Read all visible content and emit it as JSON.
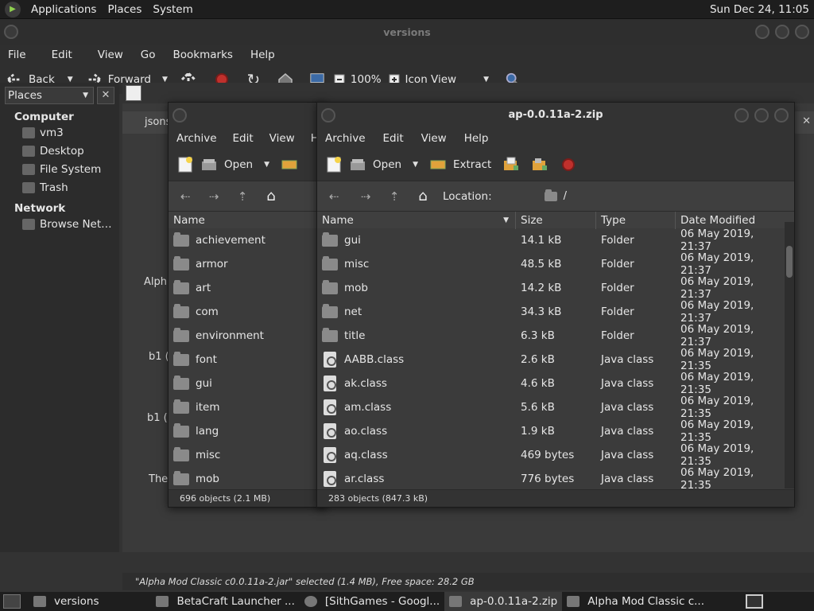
{
  "topbar": {
    "menus": [
      "Applications",
      "Places",
      "System"
    ],
    "clock": "Sun Dec 24, 11:05"
  },
  "versions_window": {
    "title": "versions",
    "menus": [
      "File",
      "Edit",
      "View",
      "Go",
      "Bookmarks",
      "Help"
    ],
    "toolbar": {
      "back": "Back",
      "forward": "Forward",
      "zoom": "100%",
      "view_mode": "Icon View"
    },
    "sidebar": {
      "combo": "Places",
      "computer_header": "Computer",
      "computer_items": [
        "vm3",
        "Desktop",
        "File System",
        "Trash"
      ],
      "network_header": "Network",
      "network_items": [
        "Browse Net…"
      ]
    },
    "tab_label": "jsons",
    "background_fragments": [
      "Alph",
      "b1 (",
      "b1 (1",
      "The"
    ],
    "status": "\"Alpha Mod Classic c0.0.11a-2.jar\" selected (1.4 MB), Free space: 28.2 GB"
  },
  "archive_left": {
    "menus": [
      "Archive",
      "Edit",
      "View",
      "Hel"
    ],
    "toolbar": {
      "open": "Open"
    },
    "column_name": "Name",
    "items": [
      "achievement",
      "armor",
      "art",
      "com",
      "environment",
      "font",
      "gui",
      "item",
      "lang",
      "misc",
      "mob"
    ],
    "status": "696 objects (2.1 MB)"
  },
  "archive_right": {
    "title": "ap-0.0.11a-2.zip",
    "menus": [
      "Archive",
      "Edit",
      "View",
      "Help"
    ],
    "toolbar": {
      "open": "Open",
      "extract": "Extract"
    },
    "location_label": "Location:",
    "location_value": "/",
    "columns": {
      "name": "Name",
      "size": "Size",
      "type": "Type",
      "date": "Date Modified"
    },
    "rows": [
      {
        "name": "gui",
        "size": "14.1 kB",
        "type": "Folder",
        "date": "06 May 2019, 21:37",
        "kind": "folder"
      },
      {
        "name": "misc",
        "size": "48.5 kB",
        "type": "Folder",
        "date": "06 May 2019, 21:37",
        "kind": "folder"
      },
      {
        "name": "mob",
        "size": "14.2 kB",
        "type": "Folder",
        "date": "06 May 2019, 21:37",
        "kind": "folder"
      },
      {
        "name": "net",
        "size": "34.3 kB",
        "type": "Folder",
        "date": "06 May 2019, 21:37",
        "kind": "folder"
      },
      {
        "name": "title",
        "size": "6.3 kB",
        "type": "Folder",
        "date": "06 May 2019, 21:37",
        "kind": "folder"
      },
      {
        "name": "AABB.class",
        "size": "2.6 kB",
        "type": "Java class",
        "date": "06 May 2019, 21:35",
        "kind": "java"
      },
      {
        "name": "ak.class",
        "size": "4.6 kB",
        "type": "Java class",
        "date": "06 May 2019, 21:35",
        "kind": "java"
      },
      {
        "name": "am.class",
        "size": "5.6 kB",
        "type": "Java class",
        "date": "06 May 2019, 21:35",
        "kind": "java"
      },
      {
        "name": "ao.class",
        "size": "1.9 kB",
        "type": "Java class",
        "date": "06 May 2019, 21:35",
        "kind": "java"
      },
      {
        "name": "aq.class",
        "size": "469 bytes",
        "type": "Java class",
        "date": "06 May 2019, 21:35",
        "kind": "java"
      },
      {
        "name": "ar.class",
        "size": "776 bytes",
        "type": "Java class",
        "date": "06 May 2019, 21:35",
        "kind": "java"
      }
    ],
    "status": "283 objects (847.3 kB)"
  },
  "taskbar": {
    "items": [
      "versions",
      "BetaCraft Launcher ...",
      "[SithGames - Googl...",
      "ap-0.0.11a-2.zip",
      "Alpha Mod Classic c..."
    ]
  }
}
